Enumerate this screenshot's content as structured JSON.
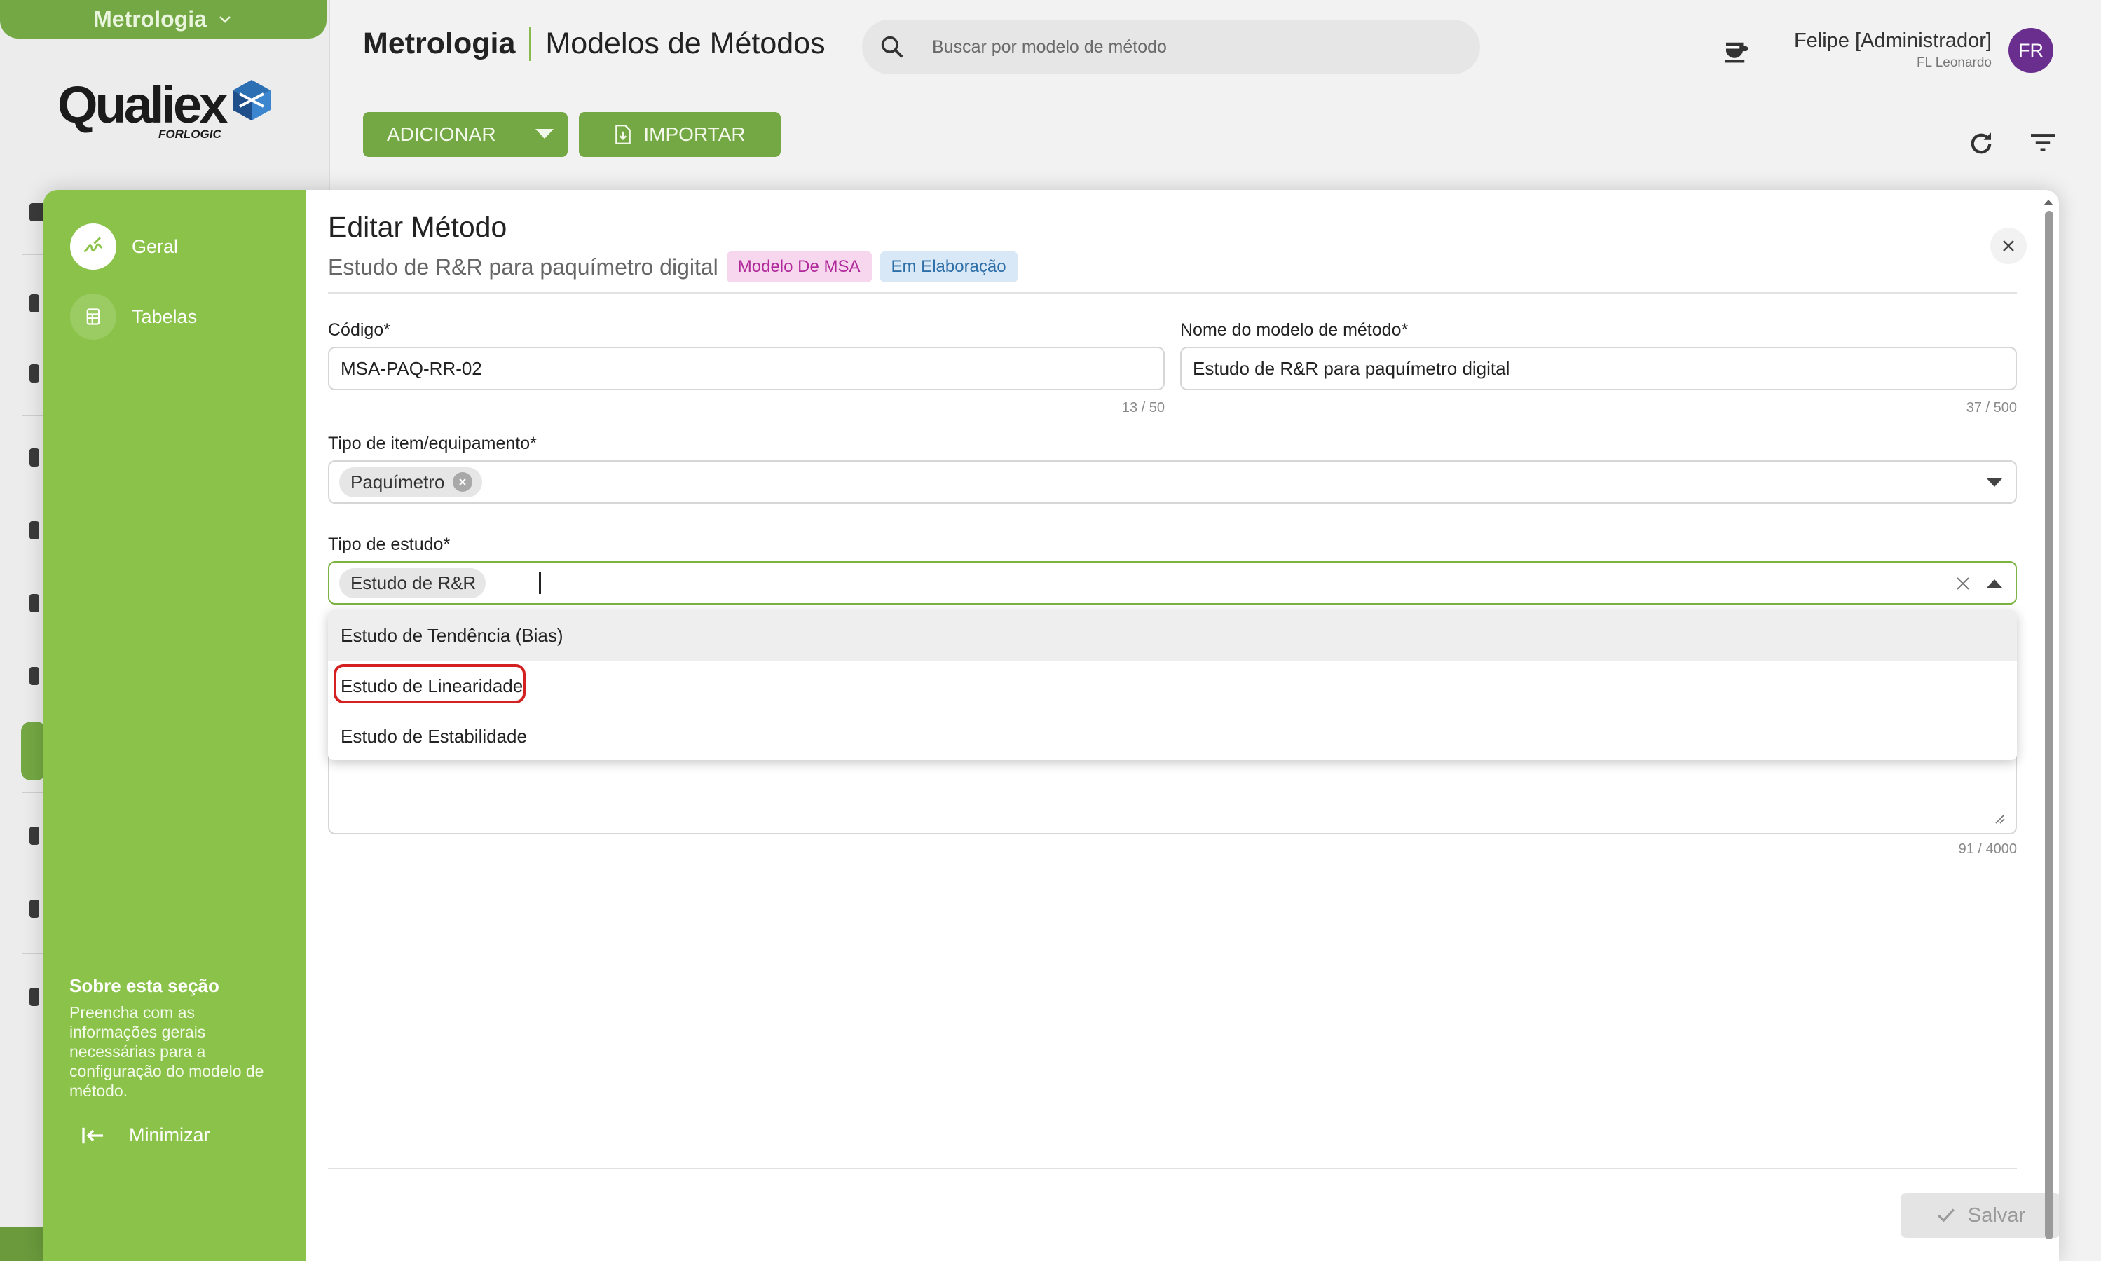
{
  "app": {
    "module_name": "Metrologia",
    "logo_text": "Qualiex",
    "logo_sub": "FORLOGIC",
    "page_title_module": "Metrologia",
    "page_title": "Modelos de Métodos",
    "search_placeholder": "Buscar por modelo de método",
    "user_name": "Felipe [Administrador]",
    "user_org": "FL Leonardo",
    "user_initials": "FR",
    "add_label": "ADICIONAR",
    "import_label": "IMPORTAR",
    "accent_color": "#74a844"
  },
  "modal": {
    "title": "Editar Método",
    "subtitle": "Estudo de R&R para paquímetro digital",
    "chip_type": "Modelo De MSA",
    "chip_status": "Em Elaboração",
    "sidebar": {
      "items": [
        {
          "label": "Geral",
          "icon": "signature-icon",
          "active": true
        },
        {
          "label": "Tabelas",
          "icon": "table-icon",
          "active": false
        }
      ],
      "about_title": "Sobre esta seção",
      "about_text": "Preencha com as informações gerais necessárias para a configuração do modelo de método.",
      "minimize_label": "Minimizar"
    },
    "fields": {
      "code": {
        "label": "Código*",
        "value": "MSA-PAQ-RR-02",
        "counter": "13 / 50"
      },
      "name": {
        "label": "Nome do modelo de método*",
        "value": "Estudo de R&R para paquímetro digital",
        "counter": "37 / 500"
      },
      "item_type": {
        "label": "Tipo de item/equipamento*",
        "tag": "Paquímetro"
      },
      "study_type": {
        "label": "Tipo de estudo*",
        "tag": "Estudo de R&R",
        "options": [
          "Estudo de Tendência (Bias)",
          "Estudo de Linearidade",
          "Estudo de Estabilidade"
        ],
        "highlighted_option": "Estudo de Tendência (Bias)",
        "marked_option": "Estudo de Linearidade"
      },
      "description_counter": "91 / 4000"
    },
    "save_label": "Salvar"
  }
}
